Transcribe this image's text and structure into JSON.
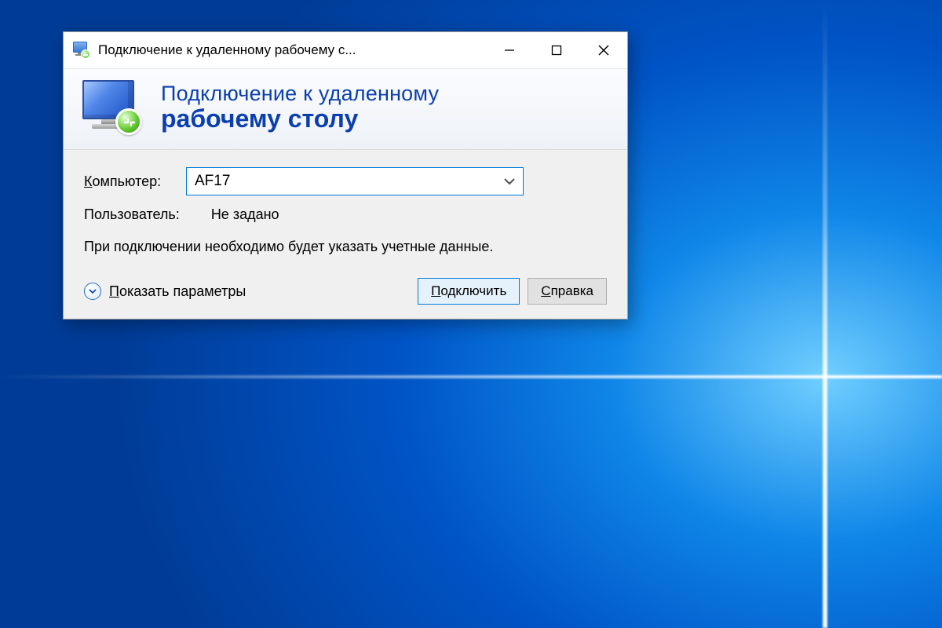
{
  "window": {
    "title": "Подключение к удаленному рабочему с..."
  },
  "banner": {
    "line1": "Подключение к удаленному",
    "line2": "рабочему столу"
  },
  "form": {
    "computer_label_pre": "К",
    "computer_label_rest": "омпьютер:",
    "computer_value": "AF17",
    "user_label": "Пользователь:",
    "user_value": "Не задано",
    "note": "При подключении необходимо будет указать учетные данные."
  },
  "footer": {
    "show_params_pre": "П",
    "show_params_rest": "оказать параметры",
    "connect_pre": "П",
    "connect_rest": "одключить",
    "help_pre": "С",
    "help_rest": "правка"
  }
}
